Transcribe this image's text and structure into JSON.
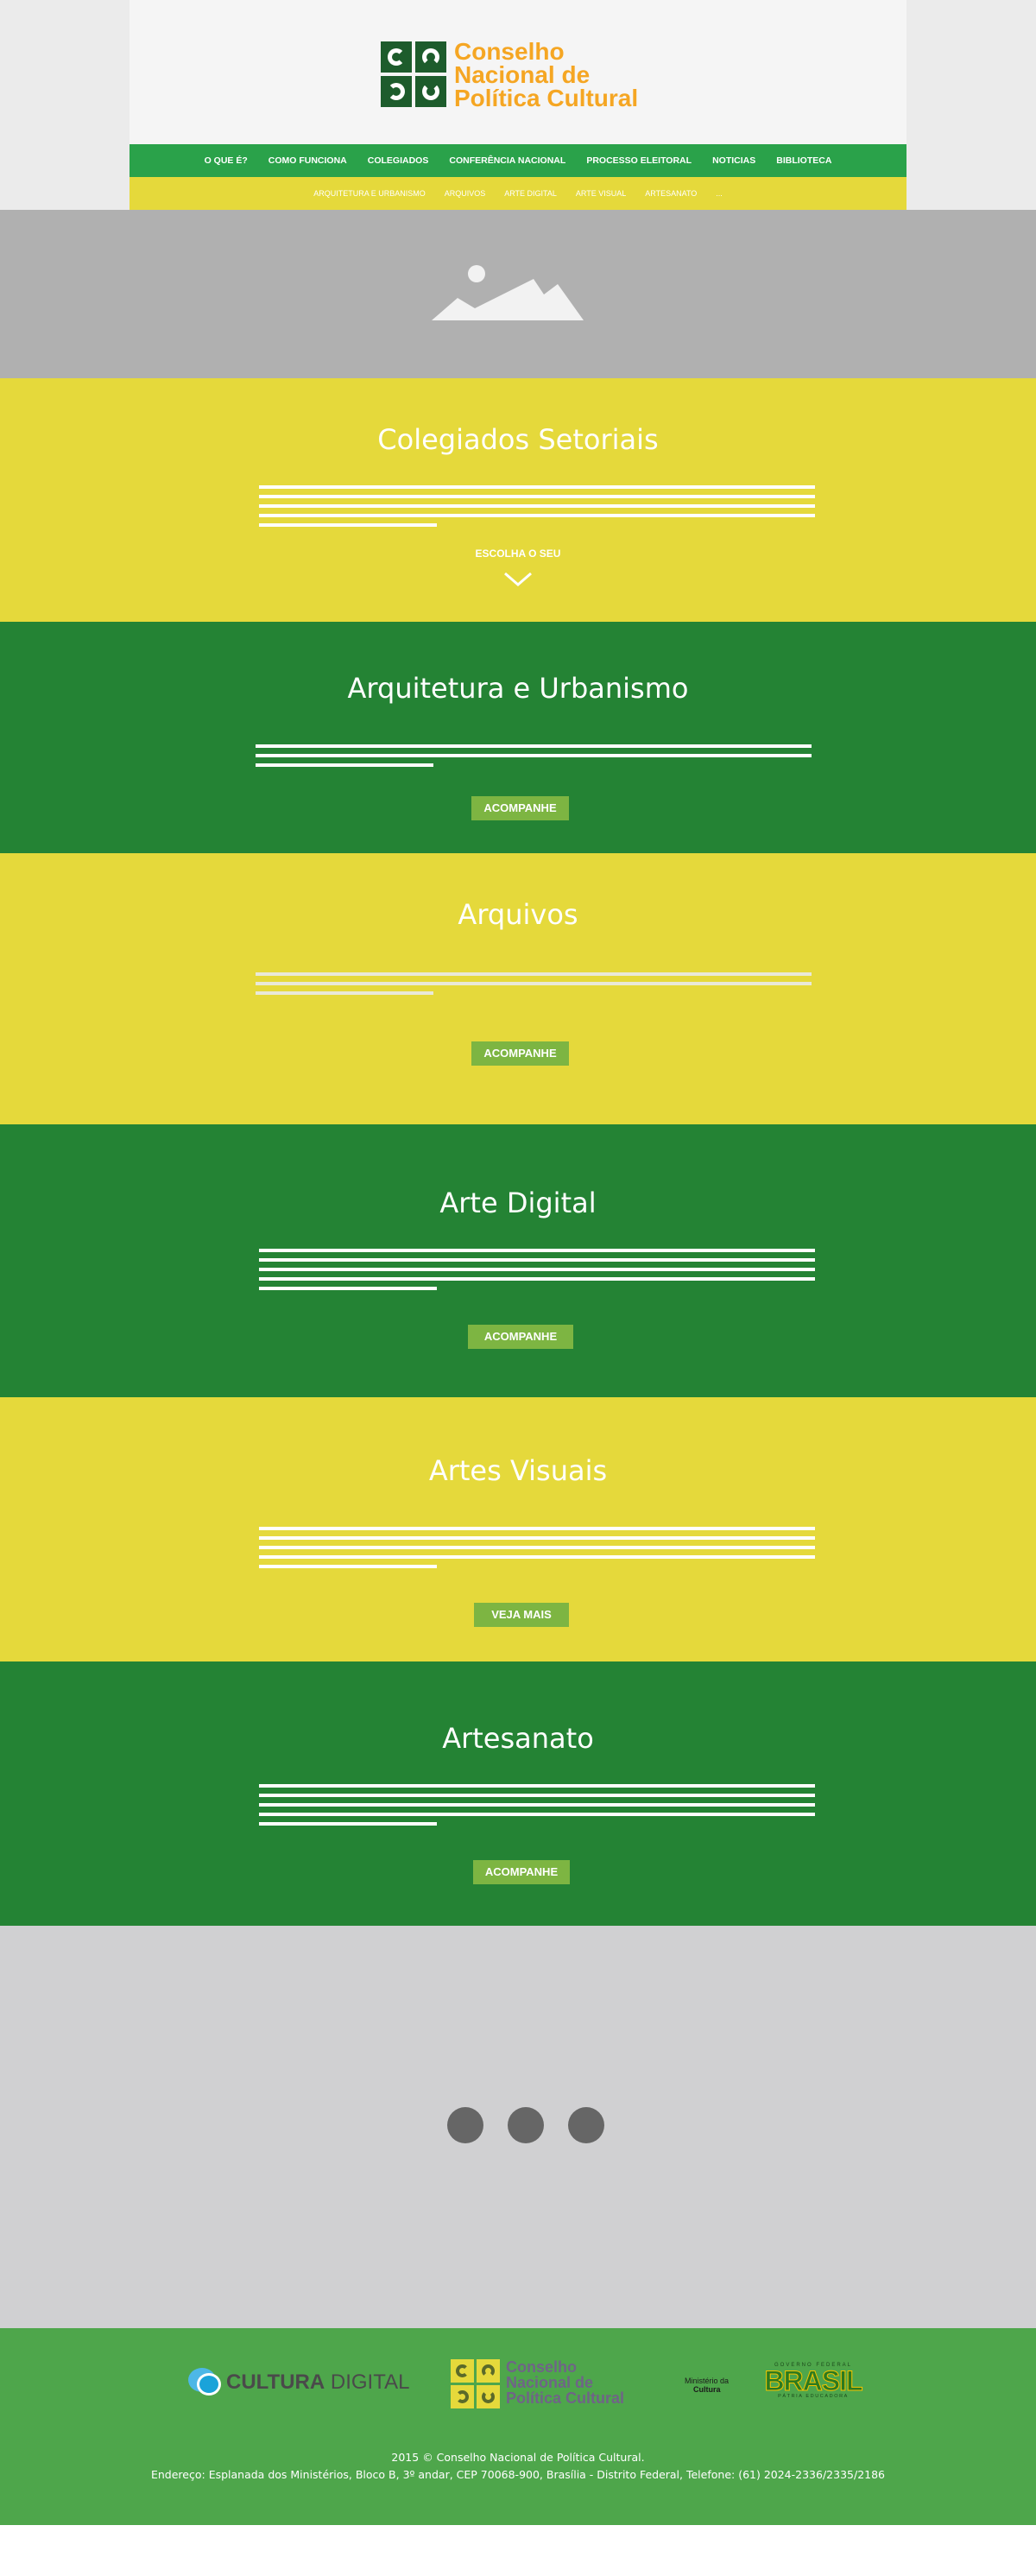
{
  "header": {
    "logo_lines": [
      "Conselho",
      "Nacional de",
      "Política Cultural"
    ],
    "brand_color": "#f5a623"
  },
  "nav_primary": [
    {
      "label": "O QUE É?"
    },
    {
      "label": "COMO FUNCIONA"
    },
    {
      "label": "COLEGIADOS"
    },
    {
      "label": "CONFERÊNCIA NACIONAL"
    },
    {
      "label": "PROCESSO ELEITORAL"
    },
    {
      "label": "NOTICIAS"
    },
    {
      "label": "BIBLIOTECA"
    }
  ],
  "nav_secondary": [
    {
      "label": "ARQUITETURA E URBANISMO"
    },
    {
      "label": "ARQUIVOS"
    },
    {
      "label": "ARTE DIGITAL"
    },
    {
      "label": "ARTE VISUAL"
    },
    {
      "label": "ARTESANATO"
    },
    {
      "label": "..."
    }
  ],
  "intro": {
    "title": "Colegiados Setoriais",
    "cta": "ESCOLHA O SEU"
  },
  "sections": [
    {
      "title": "Arquitetura e Urbanismo",
      "button": "ACOMPANHE",
      "color": "#248334"
    },
    {
      "title": "Arquivos",
      "button": "ACOMPANHE",
      "color": "#e5d93b"
    },
    {
      "title": "Arte Digital",
      "button": "ACOMPANHE",
      "color": "#248334"
    },
    {
      "title": "Artes Visuais",
      "button": "VEJA MAIS",
      "color": "#e5d93b"
    },
    {
      "title": "Artesanato",
      "button": "ACOMPANHE",
      "color": "#248334"
    }
  ],
  "footer": {
    "cultura_digital": {
      "bold": "CULTURA",
      "rest": " DIGITAL"
    },
    "cnpc_lines": [
      "Conselho",
      "Nacional de",
      "Política Cultural"
    ],
    "ministerio": [
      "Ministério da",
      "Cultura"
    ],
    "governo": {
      "top": "GOVERNO FEDERAL",
      "word": "BRASIL",
      "bottom": "PÁTRIA EDUCADORA"
    },
    "copyright": "2015 © Conselho Nacional de Política Cultural.",
    "address": "Endereço: Esplanada dos Ministérios, Bloco B, 3º andar, CEP 70068-900, Brasília - Distrito Federal, Telefone: (61) 2024-2336/2335/2186"
  },
  "colors": {
    "green_dark": "#248334",
    "green_nav": "#2aa24a",
    "yellow": "#e5d93b",
    "button": "#7db542",
    "footer": "#4ea64b"
  }
}
